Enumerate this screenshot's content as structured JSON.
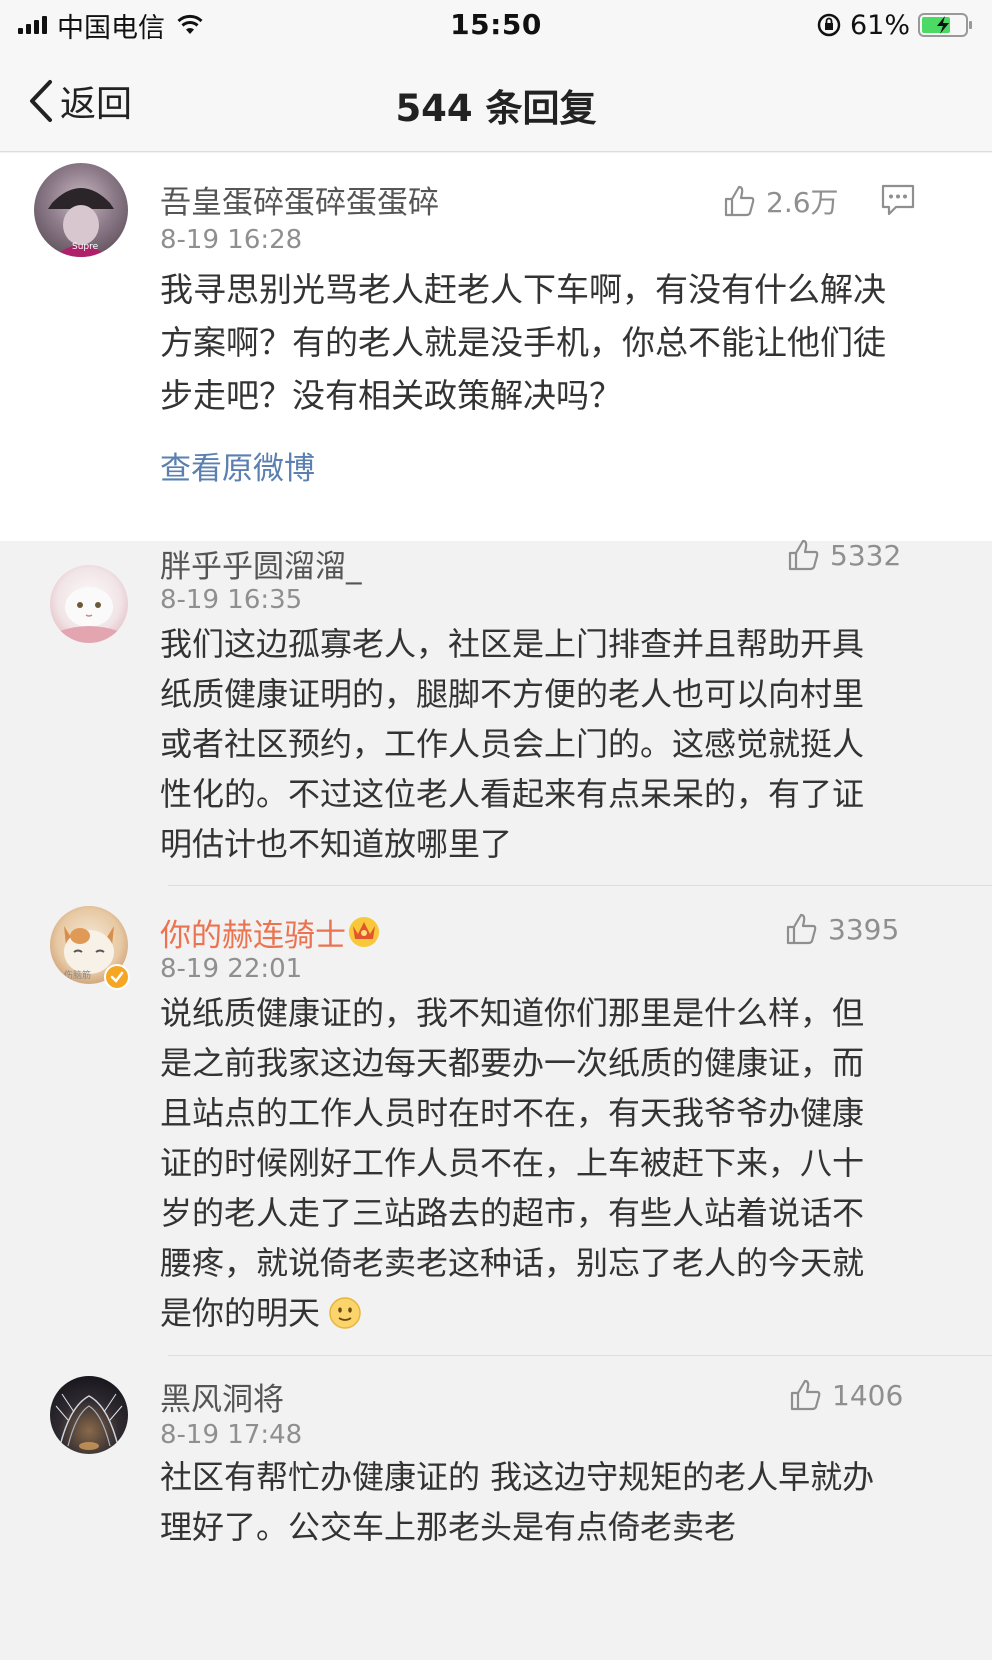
{
  "status_bar": {
    "carrier": "中国电信",
    "time": "15:50",
    "battery": "61%"
  },
  "nav": {
    "back_label": "返回",
    "title": "544 条回复"
  },
  "main_post": {
    "username": "吾皇蛋碎蛋碎蛋蛋碎",
    "timestamp": "8-19 16:28",
    "like_count": "2.6万",
    "text": "我寻思别光骂老人赶老人下车啊，有没有什么解决方案啊？有的老人就是没手机，你总不能让他们徒步走吧？没有相关政策解决吗？",
    "view_original": "查看原微博"
  },
  "replies": [
    {
      "username": "胖乎乎圆溜溜_",
      "timestamp": "8-19 16:35",
      "like_count": "5332",
      "text": "我们这边孤寡老人，社区是上门排查并且帮助开具纸质健康证明的，腿脚不方便的老人也可以向村里或者社区预约，工作人员会上门的。这感觉就挺人性化的。不过这位老人看起来有点呆呆的，有了证明估计也不知道放哪里了"
    },
    {
      "username": "你的赫连骑士",
      "timestamp": "8-19 22:01",
      "like_count": "3395",
      "text": "说纸质健康证的，我不知道你们那里是什么样，但是之前我家这边每天都要办一次纸质的健康证，而且站点的工作人员时在时不在，有天我爷爷办健康证的时候刚好工作人员不在，上车被赶下来，八十岁的老人走了三站路去的超市，有些人站着说话不腰疼，就说倚老卖老这种话，别忘了老人的今天就是你的明天",
      "badges": [
        "crown-icon",
        "verified-icon"
      ],
      "trailing_emoji": "smile-emoji"
    },
    {
      "username": "黑风洞将",
      "timestamp": "8-19 17:48",
      "like_count": "1406",
      "text": "社区有帮忙办健康证的 我这边守规矩的老人早就办理好了。公交车上那老头是有点倚老卖老"
    }
  ],
  "colors": {
    "link": "#5a7fb0",
    "vip_name": "#eb7350",
    "meta_gray": "#8f8f8f"
  }
}
